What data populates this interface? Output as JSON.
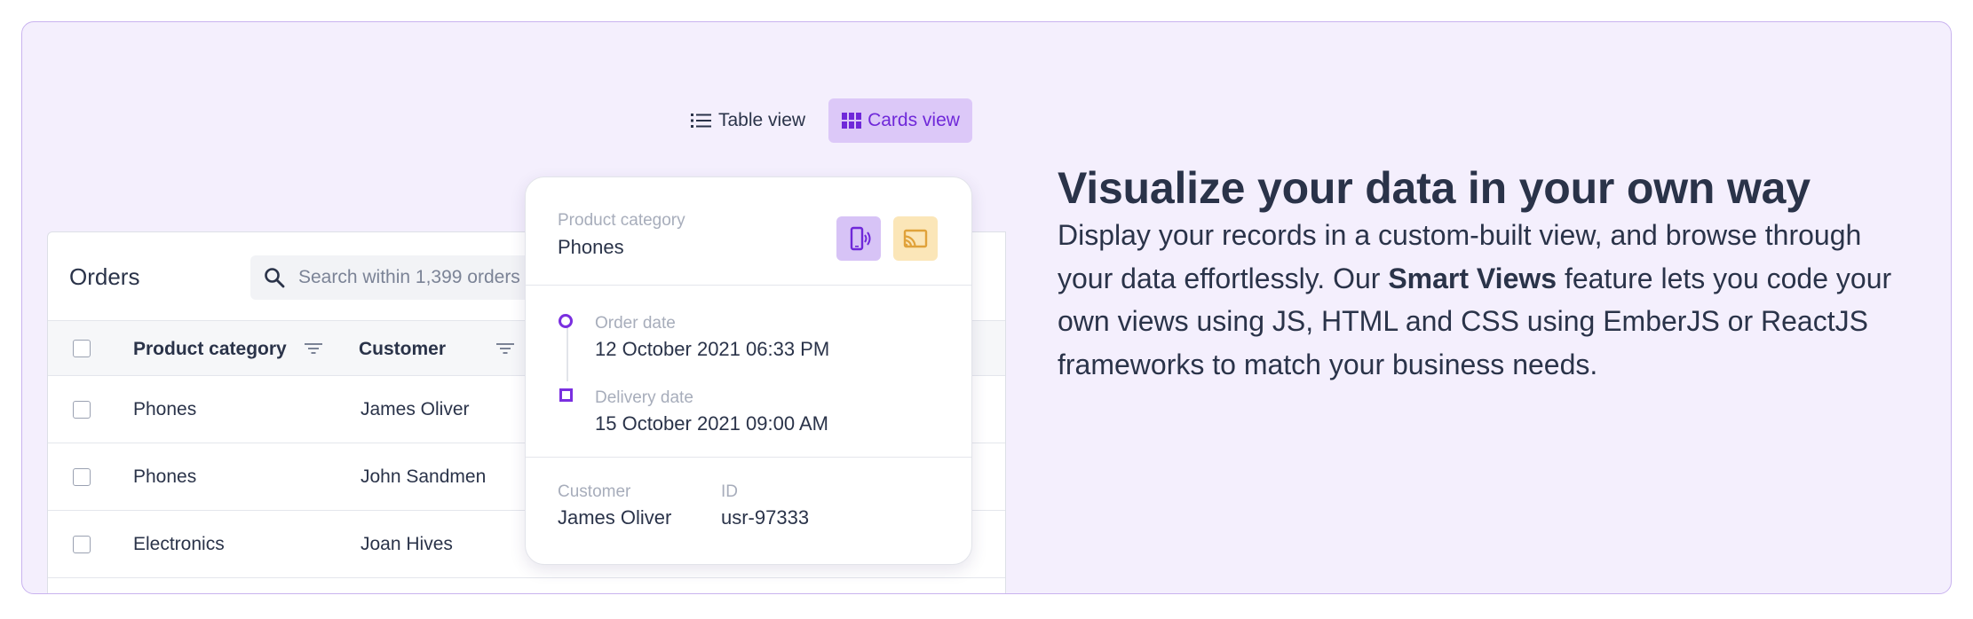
{
  "view_toggle": {
    "table_view_label": "Table view",
    "cards_view_label": "Cards view",
    "active": "Cards view"
  },
  "orders": {
    "title": "Orders",
    "search_placeholder": "Search within 1,399 orders",
    "columns": [
      "Product category",
      "Customer"
    ],
    "rows": [
      {
        "product_category": "Phones",
        "customer": "James Oliver"
      },
      {
        "product_category": "Phones",
        "customer": "John Sandmen"
      },
      {
        "product_category": "Electronics",
        "customer": "Joan Hives"
      }
    ]
  },
  "card": {
    "product_category_label": "Product category",
    "product_category_value": "Phones",
    "order_date_label": "Order date",
    "order_date_value": "12 October 2021 06:33 PM",
    "delivery_date_label": "Delivery date",
    "delivery_date_value": "15 October 2021 09:00 AM",
    "customer_label": "Customer",
    "customer_value": "James Oliver",
    "id_label": "ID",
    "id_value": "usr-97333",
    "icons": [
      "phone-signal-icon",
      "cast-icon"
    ]
  },
  "marketing": {
    "headline": "Visualize your data in your own way",
    "desc_part1": "Display your records in a custom-built view, and browse through your data effortlessly. Our ",
    "desc_bold": "Smart Views",
    "desc_part2": " feature lets you code your own views using JS, HTML and CSS using EmberJS or ReactJS frameworks to match your business needs."
  },
  "colors": {
    "panel_bg": "#f4effd",
    "panel_border": "#c9b3ef",
    "accent": "#6f28d9",
    "active_toggle_bg": "#dcc8f8",
    "text": "#2a3349"
  }
}
